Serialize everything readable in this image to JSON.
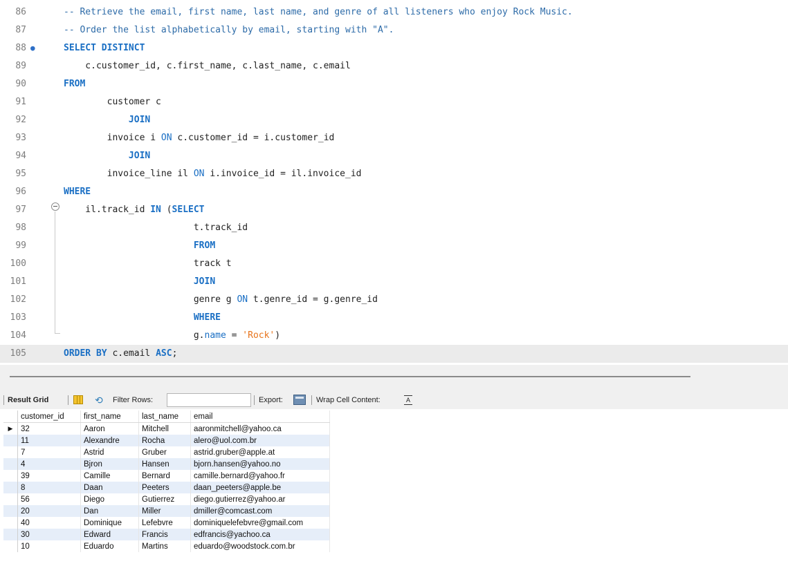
{
  "editor": {
    "lines": [
      {
        "n": "86",
        "html": "<span class=\"cm\">-- Retrieve the email, first name, last name, and genre of all listeners who enjoy Rock Music.</span>"
      },
      {
        "n": "87",
        "html": "<span class=\"cm\">-- Order the list alphabetically by email, starting with \"A\".</span>"
      },
      {
        "n": "88",
        "html": "<span class=\"kw\">SELECT DISTINCT</span>",
        "dot": true
      },
      {
        "n": "89",
        "html": "    c.customer_id, c.first_name, c.last_name, c.email"
      },
      {
        "n": "90",
        "html": "<span class=\"kw\">FROM</span>"
      },
      {
        "n": "91",
        "html": "        customer c"
      },
      {
        "n": "92",
        "html": "            <span class=\"kw\">JOIN</span>"
      },
      {
        "n": "93",
        "html": "        invoice i <span class=\"fn\">ON</span> c.customer_id = i.customer_id"
      },
      {
        "n": "94",
        "html": "            <span class=\"kw\">JOIN</span>"
      },
      {
        "n": "95",
        "html": "        invoice_line il <span class=\"fn\">ON</span> i.invoice_id = il.invoice_id"
      },
      {
        "n": "96",
        "html": "<span class=\"kw\">WHERE</span>"
      },
      {
        "n": "97",
        "html": "    il.track_id <span class=\"kw\">IN</span> (<span class=\"kw\">SELECT</span>"
      },
      {
        "n": "98",
        "html": "                        t.track_id"
      },
      {
        "n": "99",
        "html": "                        <span class=\"kw\">FROM</span>"
      },
      {
        "n": "100",
        "html": "                        track t"
      },
      {
        "n": "101",
        "html": "                        <span class=\"kw\">JOIN</span>"
      },
      {
        "n": "102",
        "html": "                        genre g <span class=\"fn\">ON</span> t.genre_id = g.genre_id"
      },
      {
        "n": "103",
        "html": "                        <span class=\"kw\">WHERE</span>"
      },
      {
        "n": "104",
        "html": "                        g.<span class=\"fn\">name</span> = <span class=\"str\">'Rock'</span>)"
      },
      {
        "n": "105",
        "html": "<span class=\"kw\">ORDER BY</span> c.email <span class=\"kw\">ASC</span>;",
        "current": true
      }
    ]
  },
  "toolbar": {
    "result_grid": "Result Grid",
    "filter_rows": "Filter Rows:",
    "filter_value": "",
    "export": "Export:",
    "wrap": "Wrap Cell Content:",
    "wrap_icon": "wrap-cell-icon",
    "grid_icon": "grid-icon",
    "refresh_icon": "refresh-icon",
    "export_icon": "export-icon"
  },
  "grid": {
    "columns": [
      "customer_id",
      "first_name",
      "last_name",
      "email"
    ],
    "rows": [
      [
        "32",
        "Aaron",
        "Mitchell",
        "aaronmitchell@yahoo.ca"
      ],
      [
        "11",
        "Alexandre",
        "Rocha",
        "alero@uol.com.br"
      ],
      [
        "7",
        "Astrid",
        "Gruber",
        "astrid.gruber@apple.at"
      ],
      [
        "4",
        "Bjron",
        "Hansen",
        "bjorn.hansen@yahoo.no"
      ],
      [
        "39",
        "Camille",
        "Bernard",
        "camille.bernard@yahoo.fr"
      ],
      [
        "8",
        "Daan",
        "Peeters",
        "daan_peeters@apple.be"
      ],
      [
        "56",
        "Diego",
        "Gutierrez",
        "diego.gutierrez@yahoo.ar"
      ],
      [
        "20",
        "Dan",
        "Miller",
        "dmiller@comcast.com"
      ],
      [
        "40",
        "Dominique",
        "Lefebvre",
        "dominiquelefebvre@gmail.com"
      ],
      [
        "30",
        "Edward",
        "Francis",
        "edfrancis@yachoo.ca"
      ],
      [
        "10",
        "Eduardo",
        "Martins",
        "eduardo@woodstock.com.br"
      ]
    ],
    "selected_row_marker": "▶"
  }
}
